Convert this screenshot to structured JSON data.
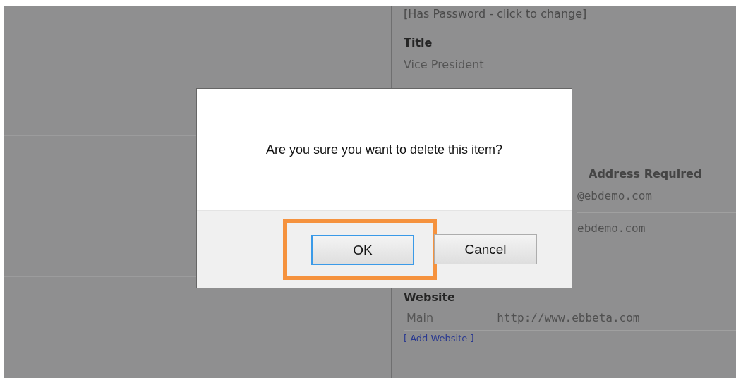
{
  "background": {
    "password_note": "[Has Password - click to change]",
    "fields": [
      {
        "label": "Title",
        "value": "Vice President"
      }
    ],
    "email": {
      "heading": "Address Required",
      "rows": [
        "@ebdemo.com",
        "ebdemo.com"
      ]
    },
    "website": {
      "label": "Website",
      "rows": [
        {
          "type": "Main",
          "url": "http://www.ebbeta.com"
        }
      ],
      "add_link": "[ Add Website ]"
    }
  },
  "dialog": {
    "message": "Are you sure you want to delete this item?",
    "buttons": [
      {
        "label": "OK",
        "focused": true,
        "highlighted": true
      },
      {
        "label": "Cancel",
        "focused": false,
        "highlighted": false
      }
    ]
  }
}
